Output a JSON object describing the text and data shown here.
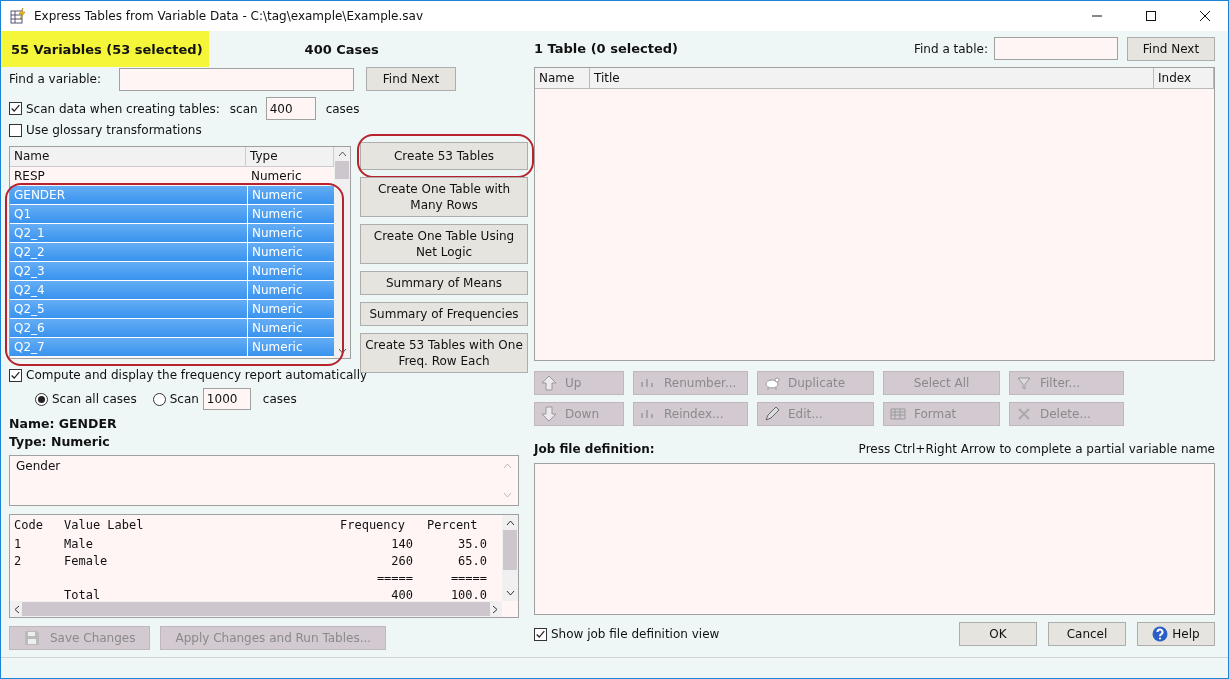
{
  "window": {
    "title": "Express Tables from Variable Data - C:\\tag\\example\\Example.sav"
  },
  "variables_header": {
    "count": "55 Variables  (53 selected)",
    "cases": "400 Cases"
  },
  "find_variable": {
    "label": "Find a variable:",
    "button": "Find Next"
  },
  "scan_data": {
    "label": "Scan data when creating tables:",
    "checked": true,
    "scan_label": "scan",
    "value": "400",
    "unit": "cases"
  },
  "glossary": {
    "label": "Use glossary transformations",
    "checked": false
  },
  "variable_list": {
    "columns": [
      "Name",
      "Type"
    ],
    "selection_highlighted": true,
    "rows": [
      {
        "name": "RESP",
        "type": "Numeric",
        "selected": false
      },
      {
        "name": "GENDER",
        "type": "Numeric",
        "selected": true
      },
      {
        "name": "Q1",
        "type": "Numeric",
        "selected": true
      },
      {
        "name": "Q2_1",
        "type": "Numeric",
        "selected": true
      },
      {
        "name": "Q2_2",
        "type": "Numeric",
        "selected": true
      },
      {
        "name": "Q2_3",
        "type": "Numeric",
        "selected": true
      },
      {
        "name": "Q2_4",
        "type": "Numeric",
        "selected": true
      },
      {
        "name": "Q2_5",
        "type": "Numeric",
        "selected": true
      },
      {
        "name": "Q2_6",
        "type": "Numeric",
        "selected": true
      },
      {
        "name": "Q2_7",
        "type": "Numeric",
        "selected": true
      }
    ]
  },
  "create_buttons": [
    {
      "label": "Create 53 Tables",
      "highlighted": true
    },
    {
      "label": "Create One Table with Many Rows",
      "highlighted": false
    },
    {
      "label": "Create One Table Using Net Logic",
      "highlighted": false
    },
    {
      "label": "Summary of Means",
      "highlighted": false
    },
    {
      "label": "Summary of Frequencies",
      "highlighted": false
    },
    {
      "label": "Create 53 Tables with One Freq. Row Each",
      "highlighted": false
    }
  ],
  "frequency_report": {
    "label": "Compute and display the frequency report automatically",
    "checked": true,
    "options": [
      {
        "label": "Scan all cases",
        "selected": true
      },
      {
        "label": "Scan",
        "selected": false,
        "value": "1000",
        "unit": "cases"
      }
    ]
  },
  "variable_info": {
    "name_label": "Name: GENDER",
    "type_label": "Type: Numeric",
    "description": "Gender"
  },
  "value_table": {
    "columns": [
      "Code",
      "Value Label",
      "Frequency",
      "Percent"
    ],
    "rows": [
      [
        "1",
        "Male",
        "140",
        "35.0"
      ],
      [
        "2",
        "Female",
        "260",
        "65.0"
      ],
      [
        "",
        "",
        "=====",
        "====="
      ],
      [
        "",
        "Total",
        "400",
        "100.0"
      ]
    ]
  },
  "left_buttons": [
    {
      "label": "Save Changes",
      "disabled": true
    },
    {
      "label": "Apply Changes and Run Tables...",
      "disabled": true
    }
  ],
  "tables_header": {
    "count": "1 Table  (0 selected)",
    "find_label": "Find a table:",
    "find_button": "Find Next"
  },
  "table_list": {
    "columns": [
      "Name",
      "Title",
      "Index"
    ]
  },
  "table_tools": [
    {
      "label": "Up",
      "disabled": true
    },
    {
      "label": "Renumber...",
      "disabled": true
    },
    {
      "label": "Duplicate",
      "disabled": true
    },
    {
      "label": "Select All",
      "disabled": true
    },
    {
      "label": "Filter...",
      "disabled": true
    },
    {
      "label": "Down",
      "disabled": true
    },
    {
      "label": "Reindex...",
      "disabled": true
    },
    {
      "label": "Edit...",
      "disabled": true
    },
    {
      "label": "Format",
      "disabled": true
    },
    {
      "label": "Delete...",
      "disabled": true
    }
  ],
  "job_file": {
    "label": "Job file definition:",
    "hint": "Press Ctrl+Right Arrow to complete a partial variable name"
  },
  "show_job_file": {
    "label": "Show job file definition view",
    "checked": true
  },
  "dialog_buttons": [
    {
      "label": "OK",
      "kind": "plain"
    },
    {
      "label": "Cancel",
      "kind": "plain"
    },
    {
      "label": "Help",
      "kind": "help"
    }
  ]
}
